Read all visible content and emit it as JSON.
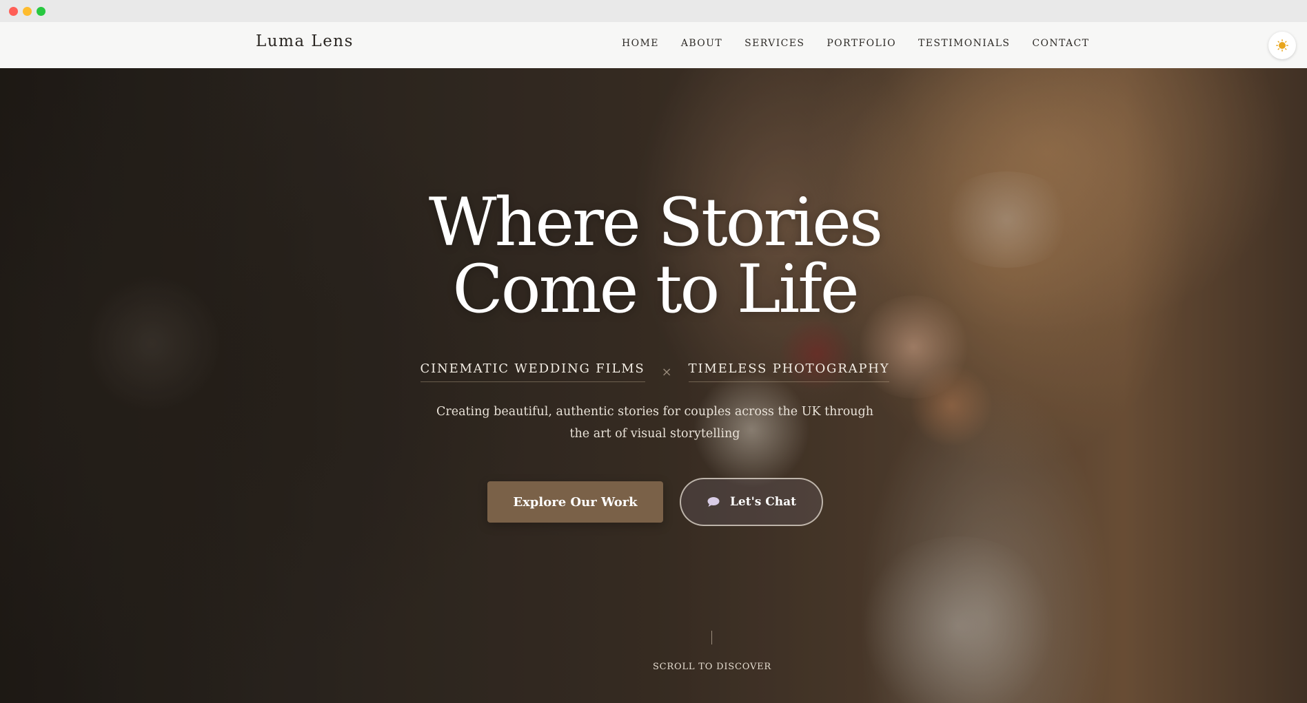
{
  "window": {
    "controls": [
      "close",
      "minimize",
      "maximize"
    ]
  },
  "nav": {
    "brand": "Luma Lens",
    "links": [
      "HOME",
      "ABOUT",
      "SERVICES",
      "PORTFOLIO",
      "TESTIMONIALS",
      "CONTACT"
    ],
    "theme_toggle_icon": "sun-icon"
  },
  "hero": {
    "title_line1": "Where Stories",
    "title_line2": "Come to Life",
    "subtitle_left": "CINEMATIC WEDDING FILMS",
    "subtitle_separator": "×",
    "subtitle_right": "TIMELESS PHOTOGRAPHY",
    "description_line1": "Creating beautiful, authentic stories for couples across the UK through",
    "description_line2": "the art of visual storytelling",
    "primary_button": "Explore Our Work",
    "chat_button": "Let's Chat",
    "chat_icon": "chat-bubble-icon",
    "scroll_label": "SCROLL TO DISCOVER"
  },
  "colors": {
    "primary_button": "#7a6148",
    "nav_bg": "#f7f7f6",
    "accent_sun": "#e8a51c"
  }
}
